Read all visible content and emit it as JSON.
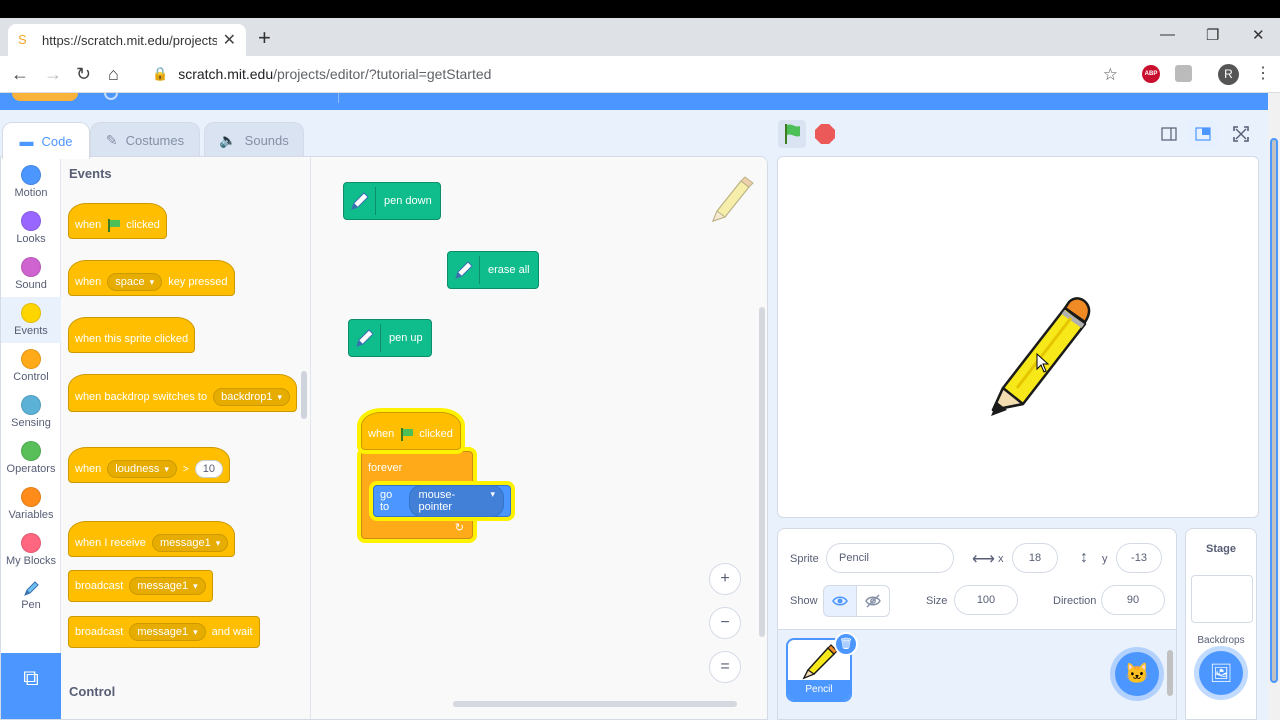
{
  "browser": {
    "tab_title": "https://scratch.mit.edu/projects/e",
    "url_host": "scratch.mit.edu",
    "url_path": "/projects/editor/?tutorial=getStarted",
    "new_tab": "+",
    "profile_initial": "R",
    "ext_abp": "ABP"
  },
  "editor_tabs": [
    {
      "label": "Code",
      "icon": "code-icon"
    },
    {
      "label": "Costumes",
      "icon": "brush-icon"
    },
    {
      "label": "Sounds",
      "icon": "speaker-icon"
    }
  ],
  "categories": [
    {
      "label": "Motion",
      "color": "#4c97ff"
    },
    {
      "label": "Looks",
      "color": "#9966ff"
    },
    {
      "label": "Sound",
      "color": "#cf63cf"
    },
    {
      "label": "Events",
      "color": "#ffd500"
    },
    {
      "label": "Control",
      "color": "#ffab19"
    },
    {
      "label": "Sensing",
      "color": "#5cb1d6"
    },
    {
      "label": "Operators",
      "color": "#59c059"
    },
    {
      "label": "Variables",
      "color": "#ff8c1a"
    },
    {
      "label": "My Blocks",
      "color": "#ff6680"
    },
    {
      "label": "Pen",
      "color": "#0fbd8c"
    }
  ],
  "palette": {
    "heading_events": "Events",
    "heading_control": "Control",
    "when": "when",
    "clicked": "clicked",
    "key_option": "space",
    "key_pressed": "key pressed",
    "sprite_clicked": "when this sprite clicked",
    "backdrop_switches": "when backdrop switches to",
    "backdrop_option": "backdrop1",
    "loudness_option": "loudness",
    "gt": ">",
    "loudness_value": "10",
    "when_i_receive": "when I receive",
    "message_option": "message1",
    "broadcast": "broadcast",
    "and_wait": "and wait"
  },
  "workspace": {
    "pen_down": "pen down",
    "erase_all": "erase all",
    "pen_up": "pen up",
    "script": {
      "when": "when",
      "clicked": "clicked",
      "forever": "forever",
      "go_to": "go to",
      "target": "mouse-pointer"
    },
    "zoom_in": "+",
    "zoom_out": "−",
    "zoom_reset": "="
  },
  "sprite_info": {
    "sprite_label": "Sprite",
    "sprite_name": "Pencil",
    "x_label": "x",
    "x_value": "18",
    "y_label": "y",
    "y_value": "-13",
    "show_label": "Show",
    "size_label": "Size",
    "size_value": "100",
    "direction_label": "Direction",
    "direction_value": "90"
  },
  "sprites": [
    {
      "name": "Pencil",
      "selected": true
    }
  ],
  "stage_pane": {
    "title": "Stage",
    "backdrops_label": "Backdrops"
  }
}
